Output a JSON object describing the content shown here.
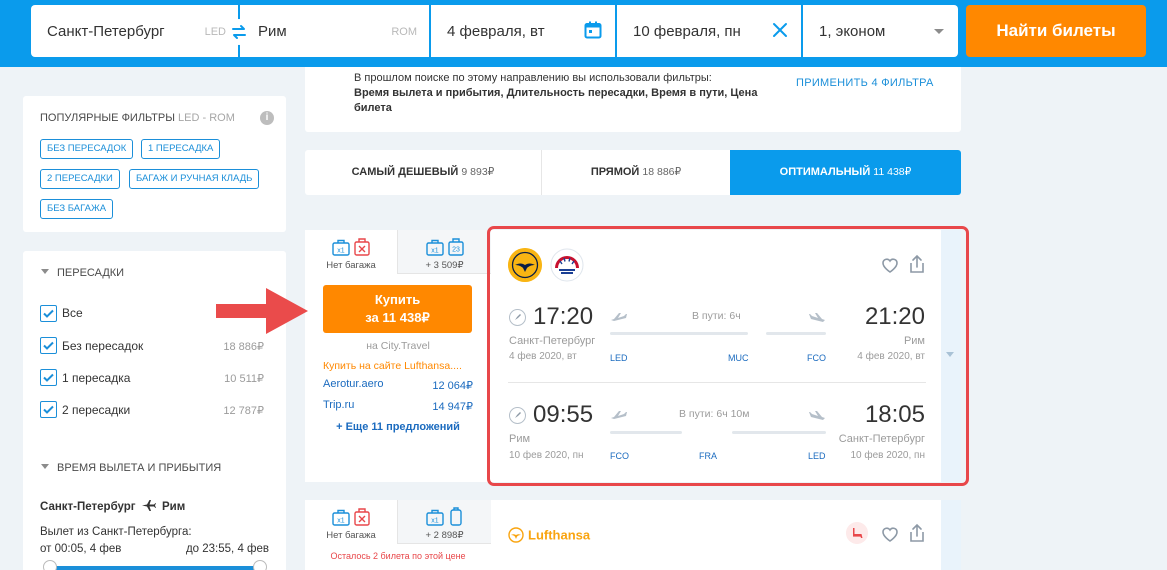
{
  "search": {
    "from_city": "Санкт-Петербург",
    "from_code": "LED",
    "to_city": "Рим",
    "to_code": "ROM",
    "depart_date": "4 февраля, вт",
    "return_date": "10 февраля, пн",
    "passengers": "1, эконом",
    "find_button": "Найти билеты"
  },
  "popular_filters": {
    "title": "Популярные фильтры",
    "route": "LED - ROM",
    "info": "i",
    "chips": [
      "Без пересадок",
      "1 пересадка",
      "2 пересадки",
      "Багаж и ручная кладь",
      "Без багажа"
    ]
  },
  "transfers": {
    "title": "Пересадки",
    "options": [
      {
        "label": "Все",
        "price": ""
      },
      {
        "label": "Без пересадок",
        "price": "18 886₽"
      },
      {
        "label": "1 пересадка",
        "price": "10 511₽"
      },
      {
        "label": "2 пересадки",
        "price": "12 787₽"
      }
    ]
  },
  "times": {
    "title": "Время вылета и прибытия",
    "direction_from": "Санкт-Петербург",
    "direction_to": "Рим",
    "depart_label": "Вылет из Санкт-Петербурга:",
    "range_from": "от 00:05, 4 фев",
    "range_to": "до 23:55, 4 фев"
  },
  "notice": {
    "line1": "В прошлом поиске по этому направлению вы использовали фильтры:",
    "line2": "Время вылета и прибытия, Длительность пересадки, Время в пути, Цена билета",
    "apply": "ПРИМЕНИТЬ 4 ФИЛЬТРА"
  },
  "tabs": [
    {
      "label": "САМЫЙ ДЕШЕВЫЙ",
      "price": "9 893₽"
    },
    {
      "label": "ПРЯМОЙ",
      "price": "18 886₽"
    },
    {
      "label": "ОПТИМАЛЬНЫЙ",
      "price": "11 438₽"
    }
  ],
  "ticket1": {
    "bag_no": "Нет багажа",
    "bag_plus": "+ 3 509₽",
    "bag_count": "x1",
    "bag_kg": "23",
    "buy_line1": "Купить",
    "buy_line2": "за 11 438₽",
    "via": "на City.Travel",
    "buy_site": "Купить на сайте Lufthansa....",
    "agents": [
      {
        "name": "Aerotur.aero",
        "price": "12 064₽"
      },
      {
        "name": "Trip.ru",
        "price": "14 947₽"
      }
    ],
    "more": "+ Еще 11 предложений",
    "out": {
      "dep_time": "17:20",
      "dep_city": "Санкт-Петербург",
      "dep_date": "4 фев 2020, вт",
      "arr_time": "21:20",
      "arr_city": "Рим",
      "arr_date": "4 фев 2020, вт",
      "duration": "В пути: 6ч",
      "codes": [
        "LED",
        "MUC",
        "FCO"
      ]
    },
    "back": {
      "dep_time": "09:55",
      "dep_city": "Рим",
      "dep_date": "10 фев 2020, пн",
      "arr_time": "18:05",
      "arr_city": "Санкт-Петербург",
      "arr_date": "10 фев 2020, пн",
      "duration": "В пути: 6ч 10м",
      "codes": [
        "FCO",
        "FRA",
        "LED"
      ]
    }
  },
  "ticket2": {
    "bag_no": "Нет багажа",
    "bag_plus": "+ 2 898₽",
    "bag_count": "x1",
    "warning": "Осталось 2 билета по этой цене",
    "airline": "Lufthansa"
  },
  "colors": {
    "brand": "#0a9bec",
    "accent": "#ff8800",
    "highlight": "#e8474a",
    "link": "#1b8fd9"
  }
}
